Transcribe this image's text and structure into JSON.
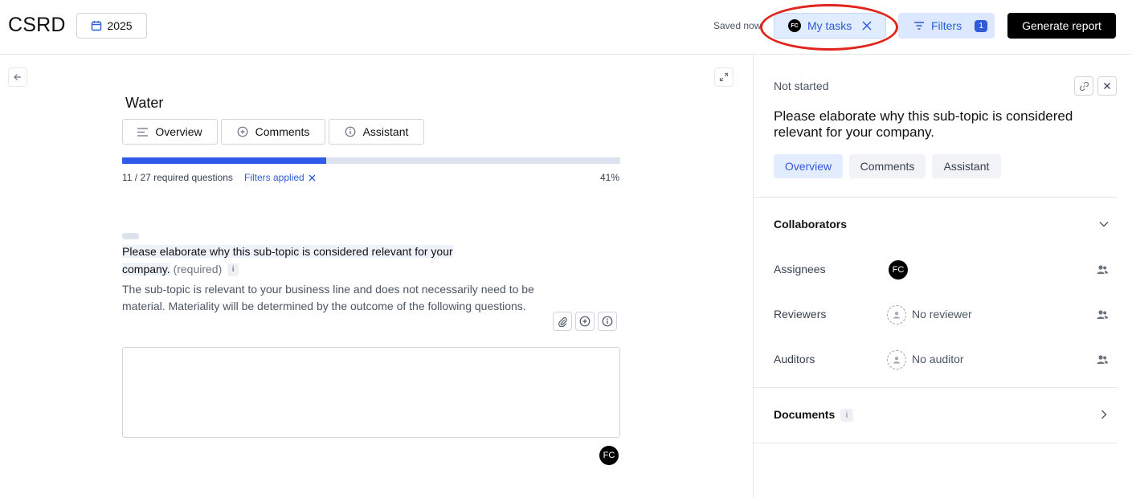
{
  "header": {
    "app_title": "CSRD",
    "year": "2025",
    "saved_status": "Saved now",
    "my_tasks": {
      "label": "My tasks",
      "avatar": "FC"
    },
    "filters": {
      "label": "Filters",
      "count": "1"
    },
    "generate_report_label": "Generate report"
  },
  "topic": {
    "title": "Water",
    "tabs": [
      {
        "label": "Overview",
        "icon": "lines-icon"
      },
      {
        "label": "Comments",
        "icon": "chat-plus-icon"
      },
      {
        "label": "Assistant",
        "icon": "info-circle-icon"
      }
    ],
    "progress": {
      "fraction": 0.41,
      "text": "11 / 27 required questions",
      "filters_applied": "Filters applied",
      "percent": "41%"
    }
  },
  "question": {
    "text_line1": "Please elaborate why this sub-topic is considered relevant for your",
    "text_line2": "company.",
    "required": "(required)",
    "info": "i",
    "description": "The sub-topic is relevant to your business line and does not necessarily need to be material. Materiality will be determined by the outcome of the following questions.",
    "answer_value": "",
    "author_avatar": "FC"
  },
  "panel": {
    "status": "Not started",
    "title": "Please elaborate why this sub-topic is considered relevant for your company.",
    "tabs": [
      "Overview",
      "Comments",
      "Assistant"
    ],
    "active_tab": "Overview",
    "collaborators": {
      "title": "Collaborators",
      "assignees_label": "Assignees",
      "assignee_avatar": "FC",
      "reviewers_label": "Reviewers",
      "reviewers_value": "No reviewer",
      "auditors_label": "Auditors",
      "auditors_value": "No auditor"
    },
    "documents": {
      "title": "Documents",
      "info": "i"
    }
  },
  "colors": {
    "accent": "#2f5bd8",
    "accent_bg": "#e0ecff",
    "annotation": "#e0241b",
    "progress_track": "#dde3ee"
  }
}
